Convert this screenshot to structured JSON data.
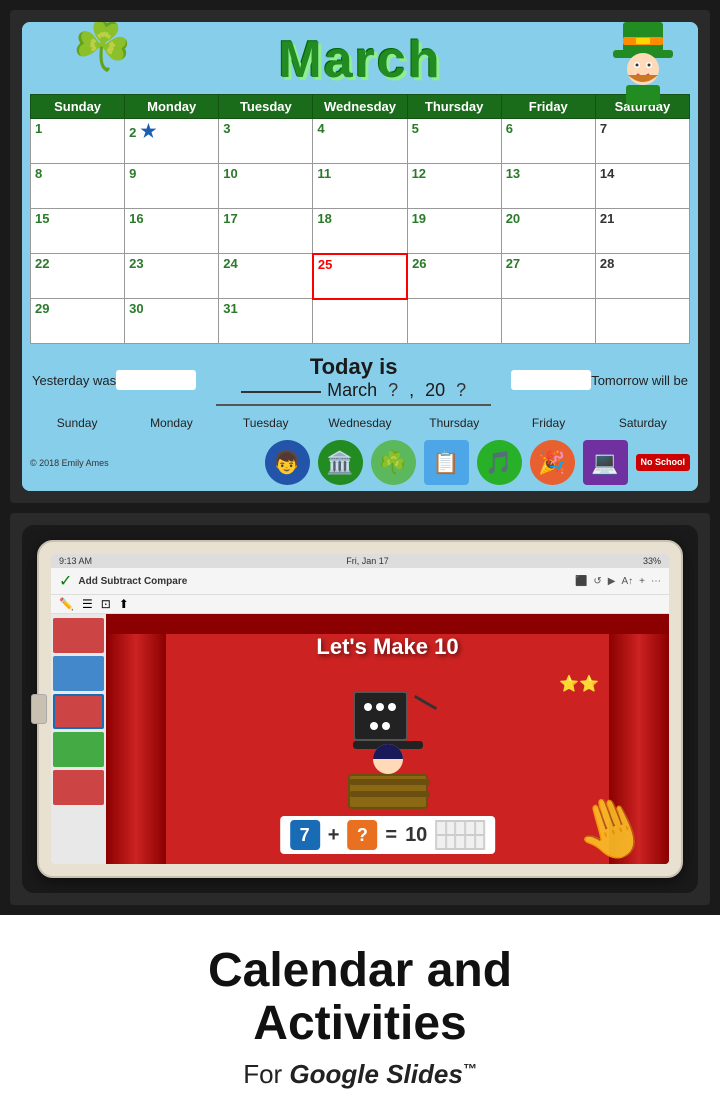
{
  "calendar": {
    "month": "March",
    "days_of_week": [
      "Sunday",
      "Monday",
      "Tuesday",
      "Wednesday",
      "Thursday",
      "Friday",
      "Saturday"
    ],
    "weeks": [
      [
        {
          "num": "1",
          "color": "green"
        },
        {
          "num": "2",
          "color": "green",
          "star": true
        },
        {
          "num": "3",
          "color": "green"
        },
        {
          "num": "4",
          "color": "green"
        },
        {
          "num": "5",
          "color": "green"
        },
        {
          "num": "6",
          "color": "green"
        },
        {
          "num": "7",
          "color": "black"
        }
      ],
      [
        {
          "num": "8",
          "color": "green"
        },
        {
          "num": "9",
          "color": "green"
        },
        {
          "num": "10",
          "color": "green"
        },
        {
          "num": "11",
          "color": "green"
        },
        {
          "num": "12",
          "color": "green"
        },
        {
          "num": "13",
          "color": "green"
        },
        {
          "num": "14",
          "color": "black"
        }
      ],
      [
        {
          "num": "15",
          "color": "green"
        },
        {
          "num": "16",
          "color": "green"
        },
        {
          "num": "17",
          "color": "green"
        },
        {
          "num": "18",
          "color": "green"
        },
        {
          "num": "19",
          "color": "green"
        },
        {
          "num": "20",
          "color": "green"
        },
        {
          "num": "21",
          "color": "black"
        }
      ],
      [
        {
          "num": "22",
          "color": "green"
        },
        {
          "num": "23",
          "color": "green"
        },
        {
          "num": "24",
          "color": "green"
        },
        {
          "num": "25",
          "color": "red_box"
        },
        {
          "num": "26",
          "color": "green"
        },
        {
          "num": "27",
          "color": "green"
        },
        {
          "num": "28",
          "color": "black"
        }
      ],
      [
        {
          "num": "29",
          "color": "green"
        },
        {
          "num": "30",
          "color": "green"
        },
        {
          "num": "31",
          "color": "green"
        },
        {
          "num": "",
          "color": ""
        },
        {
          "num": "",
          "color": ""
        },
        {
          "num": "",
          "color": ""
        },
        {
          "num": "",
          "color": ""
        }
      ]
    ],
    "today_section": {
      "yesterday_label": "Yesterday was",
      "today_label": "Today is",
      "tomorrow_label": "Tomorrow will be",
      "month_display": "March",
      "day_placeholder": "?",
      "year_short": "20",
      "year_placeholder": "?"
    },
    "icons": [
      "👦",
      "🏛️",
      "☘️",
      "📋",
      "🎵",
      "🎉",
      "💻"
    ],
    "no_school": "No School",
    "copyright": "© 2018 Emily Ames"
  },
  "tablet": {
    "status_bar": {
      "time": "9:13 AM",
      "day": "Fri, Jan 17",
      "battery": "33%",
      "wifi": "wifi"
    },
    "toolbar": {
      "title": "Add Subtract Compare",
      "menu_items": []
    },
    "slide_title": "Let's Make 10",
    "math_equation": {
      "num1": "7",
      "operator": "+",
      "unknown": "?",
      "equals": "=",
      "result": "10"
    }
  },
  "bottom": {
    "line1": "Calendar and",
    "line2": "Activities",
    "line3_prefix": "For",
    "line3_product": "Google Slides",
    "trademark": "™"
  },
  "watermark": "Emily Ames"
}
